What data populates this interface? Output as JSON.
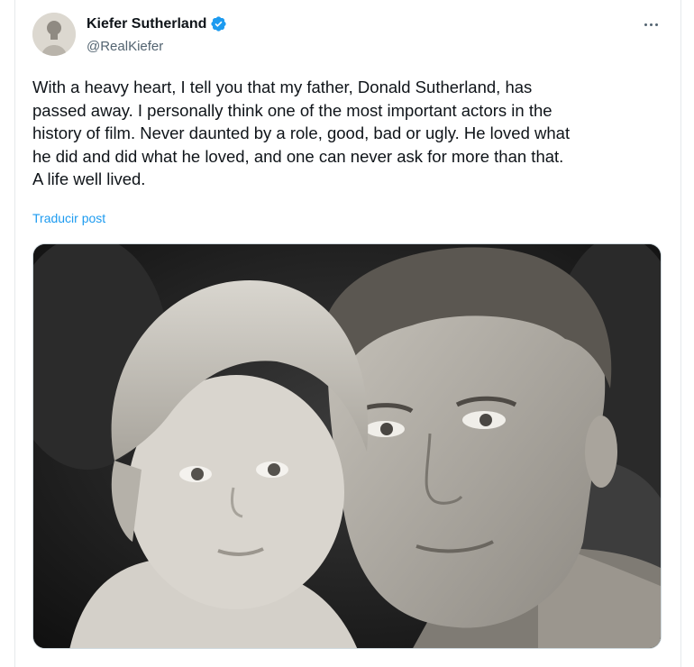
{
  "author": {
    "name": "Kiefer Sutherland",
    "handle": "@RealKiefer",
    "verified": true,
    "verified_color": "#1d9bf0"
  },
  "menu": {
    "icon": "more-horizontal-icon"
  },
  "post": {
    "lines": [
      "With a heavy heart, I tell you that my father, Donald Sutherland, has",
      "passed away. I personally think one of the most important actors in the",
      "history of film. Never daunted by a role, good, bad or ugly. He loved what",
      "he did and did what he loved, and one can never ask for more than that.",
      "A life well lived."
    ],
    "translate_label": "Traducir post"
  },
  "colors": {
    "text": "#0f1419",
    "secondary": "#536471",
    "link": "#1d9bf0"
  }
}
